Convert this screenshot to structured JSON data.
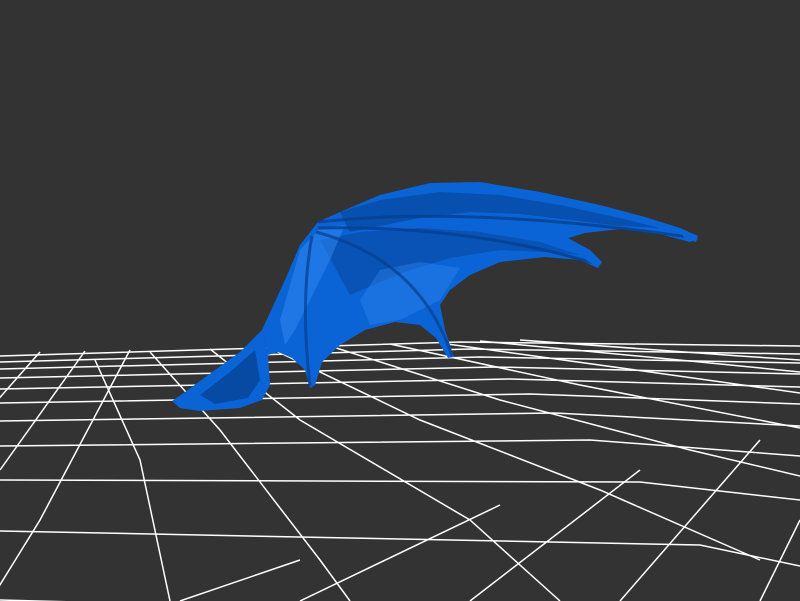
{
  "viewport": {
    "background_color": "#333333",
    "grid_color": "#ffffff",
    "model_color": "#0a64d6",
    "model_shadow_color": "#063f8f",
    "model_highlight_color": "#2f86f0",
    "grid": "on",
    "model": "bat-wing-icon"
  }
}
